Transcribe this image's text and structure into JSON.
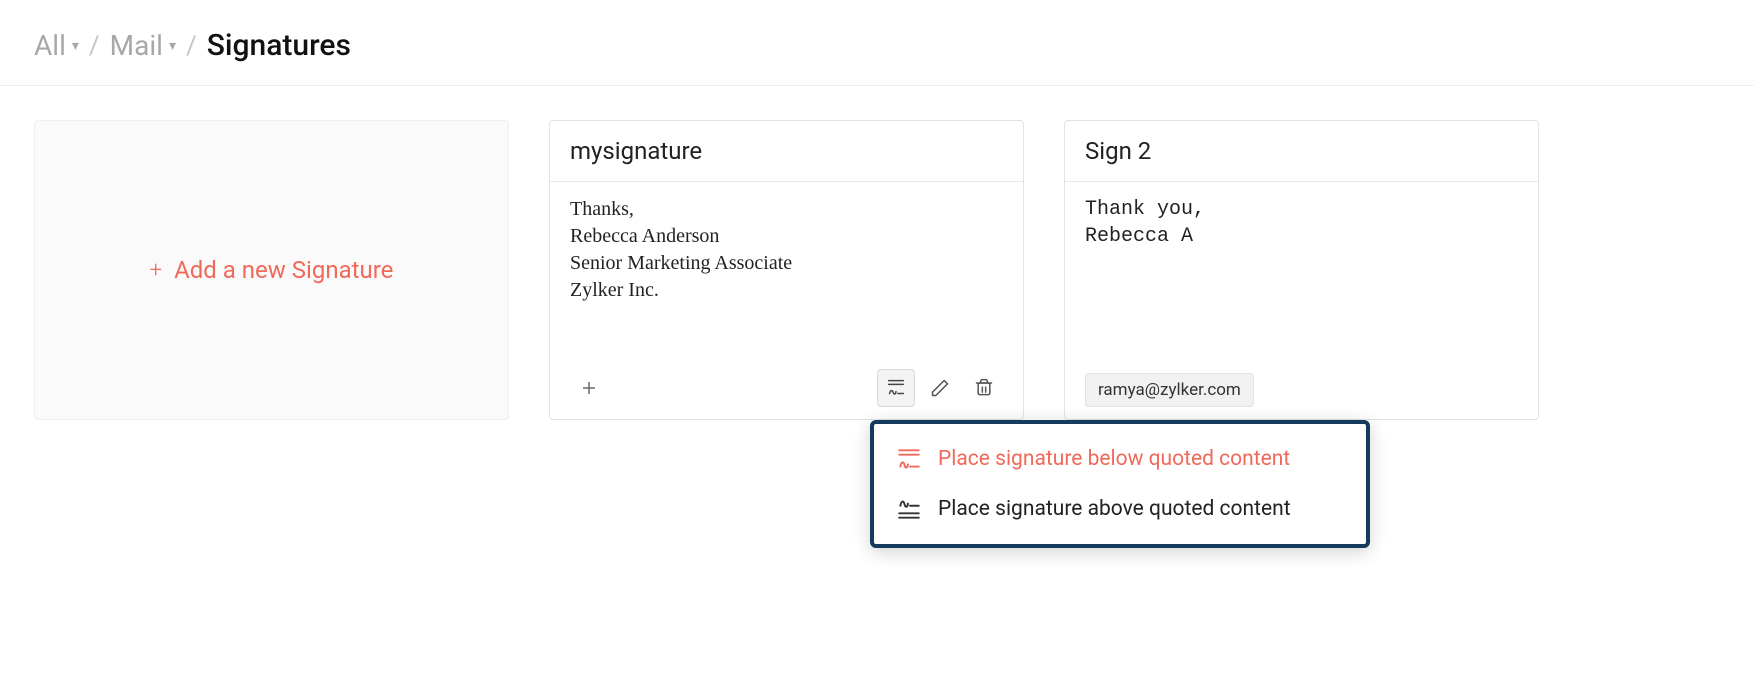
{
  "breadcrumb": {
    "items": [
      "All",
      "Mail"
    ],
    "current": "Signatures"
  },
  "add_label": "Add a new Signature",
  "signatures": [
    {
      "name": "mysignature",
      "body": "Thanks,\nRebecca Anderson\nSenior Marketing Associate\nZylker Inc."
    },
    {
      "name": "Sign 2",
      "body": "Thank you,\nRebecca A",
      "chip": "ramya@zylker.com"
    }
  ],
  "dropdown": {
    "below": "Place signature below quoted content",
    "above": "Place signature above quoted content"
  }
}
